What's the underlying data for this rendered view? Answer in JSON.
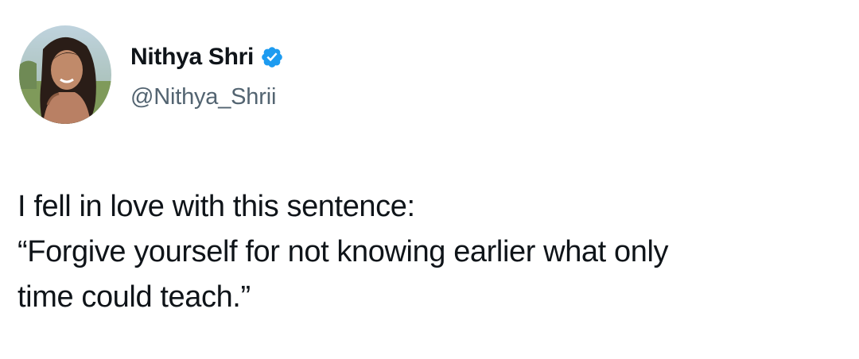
{
  "tweet": {
    "author": {
      "display_name": "Nithya Shri",
      "handle": "@Nithya_Shrii",
      "verified": true
    },
    "text_lines": [
      "I fell in love with this sentence:",
      "“Forgive yourself for not knowing earlier what only",
      "time could teach.”"
    ]
  },
  "colors": {
    "text": "#0f1419",
    "secondary_text": "#536471",
    "verified_blue": "#1d9bf0",
    "background": "#ffffff"
  }
}
